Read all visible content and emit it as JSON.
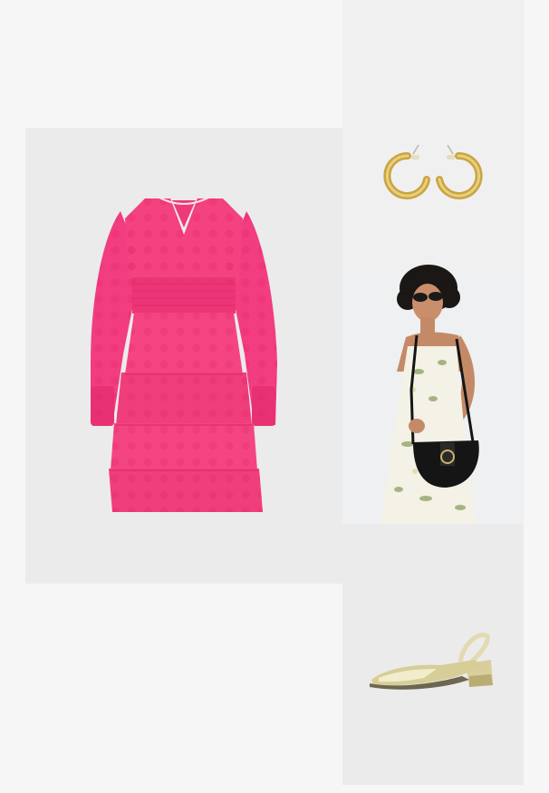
{
  "board": {
    "background_color": "#f6f6f6",
    "items": [
      {
        "id": "dress",
        "icon": "pink-tiered-dress-image",
        "accent": "#f0397c",
        "tile_bg": "#ebebeb"
      },
      {
        "id": "earring",
        "icon": "gold-hoop-earrings-image",
        "accent": "#d6b455",
        "tile_bg": "#f0f0f0"
      },
      {
        "id": "bag",
        "icon": "model-with-black-saddle-bag",
        "accent": "#151515",
        "tile_bg": "#eceeef"
      },
      {
        "id": "shoe",
        "icon": "gold-slingback-pump-image",
        "accent": "#d8cf9a",
        "tile_bg": "#ebebeb"
      }
    ]
  }
}
